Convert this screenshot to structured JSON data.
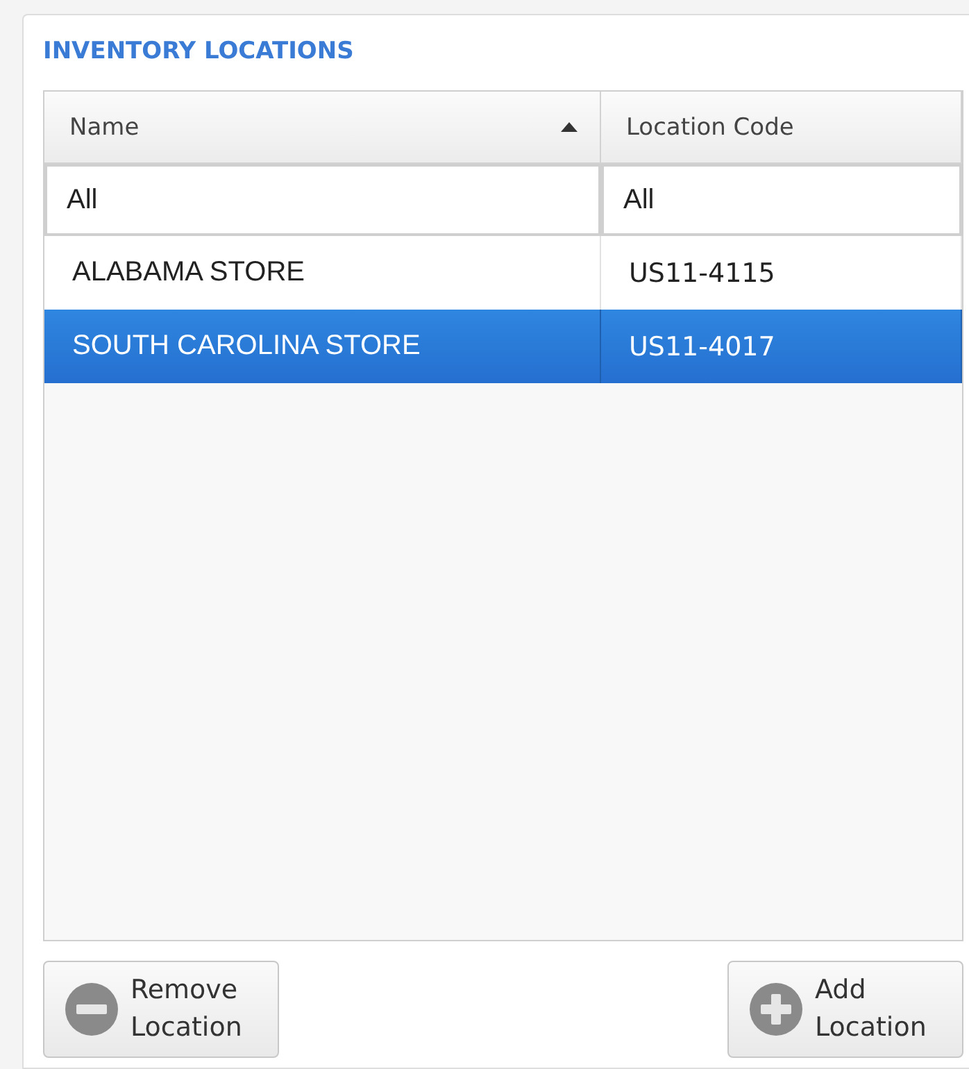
{
  "title": "INVENTORY LOCATIONS",
  "table": {
    "columns": [
      {
        "label": "Name",
        "sorted": true
      },
      {
        "label": "Location Code",
        "sorted": false
      }
    ],
    "filters": [
      {
        "value": "All"
      },
      {
        "value": "All"
      }
    ],
    "rows": [
      {
        "cells": [
          "ALABAMA STORE",
          "US11-4115"
        ],
        "selected": false
      },
      {
        "cells": [
          "SOUTH CAROLINA STORE",
          "US11-4017"
        ],
        "selected": true
      }
    ]
  },
  "buttons": [
    {
      "kind": "remove",
      "label": "Remove Location"
    },
    {
      "kind": "add",
      "label": "Add Location"
    }
  ]
}
